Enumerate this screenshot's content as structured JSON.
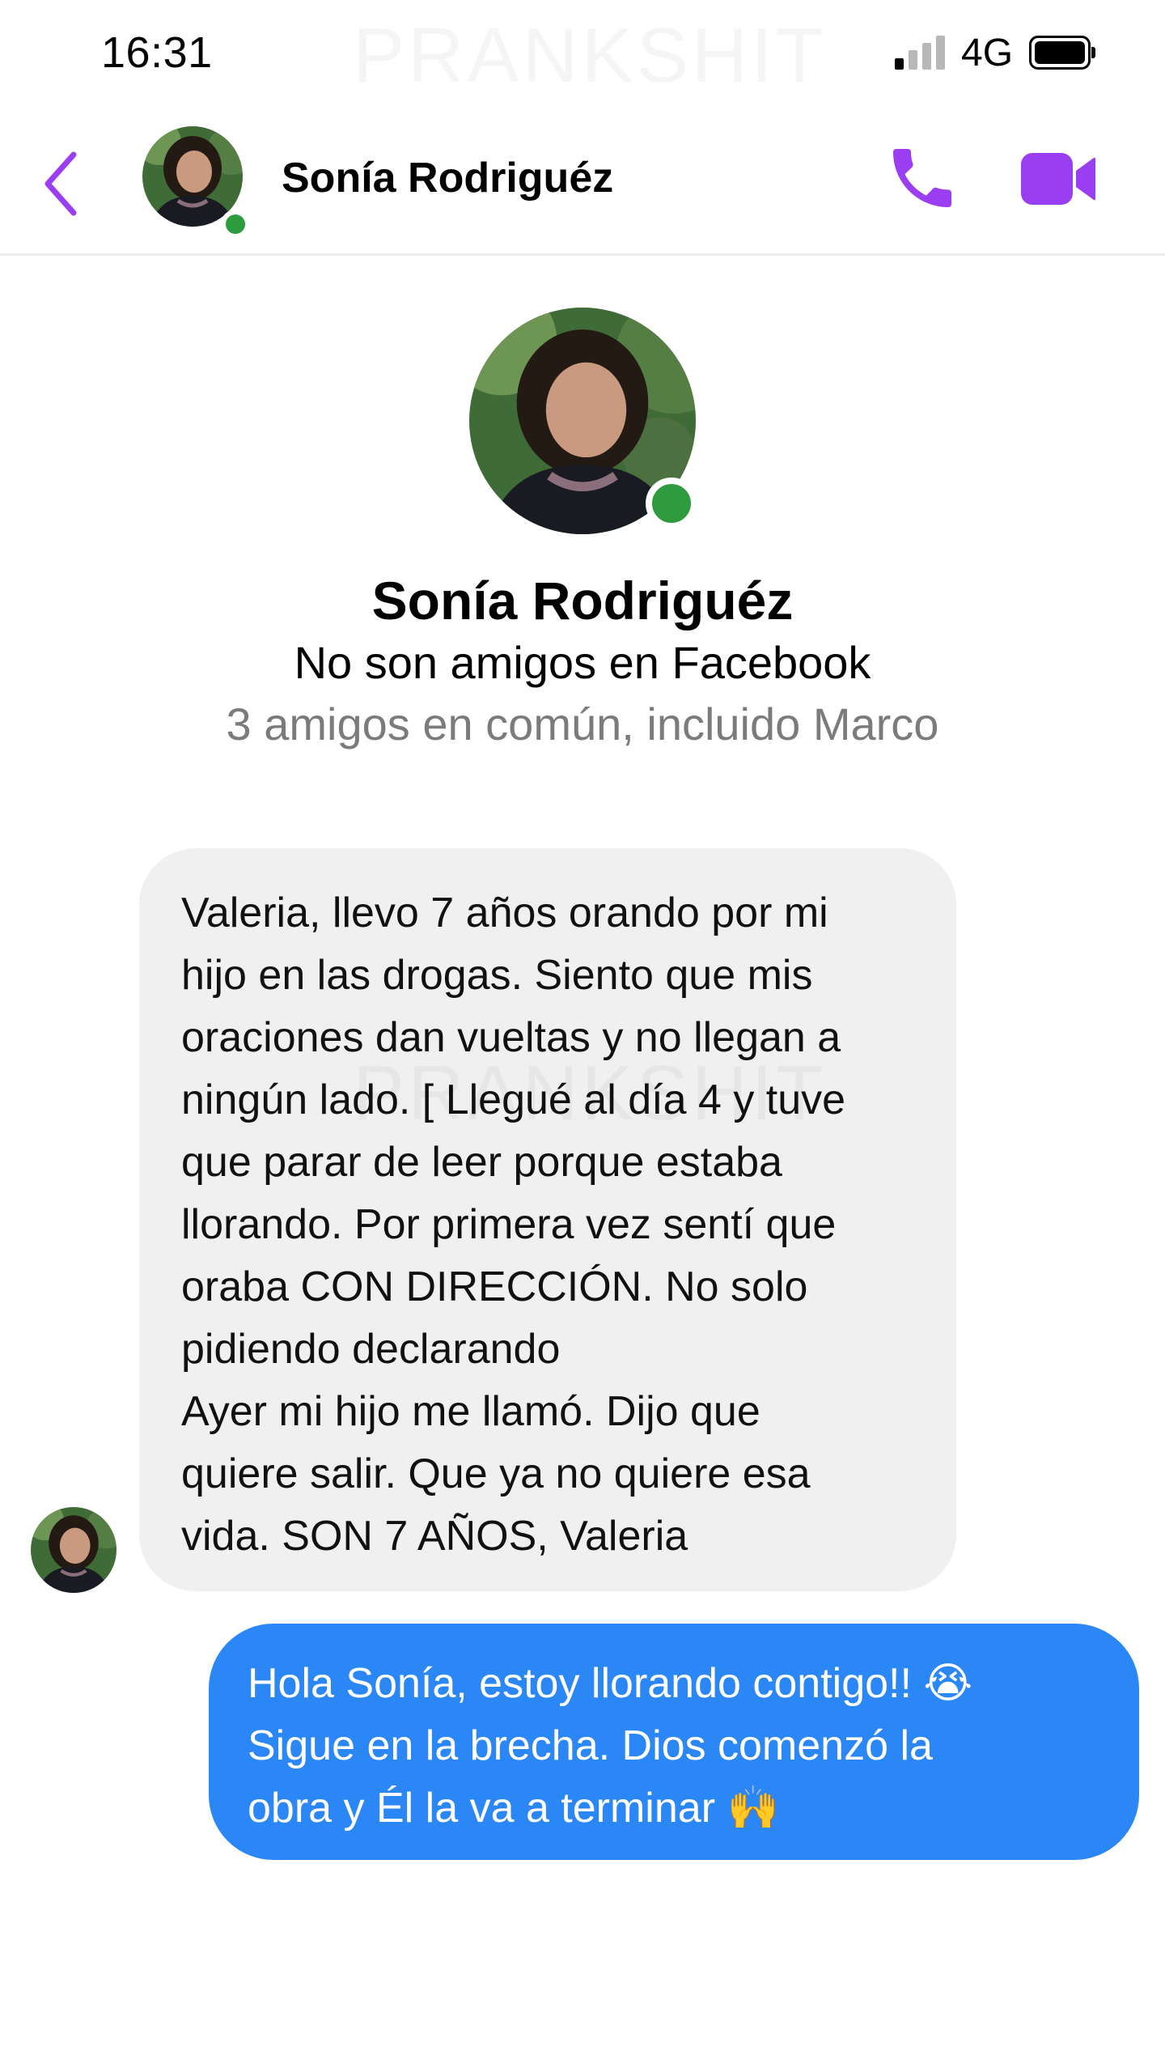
{
  "status_bar": {
    "time": "16:31",
    "network": "4G",
    "watermark": "PRANKSHIT",
    "icons": [
      "signal-icon",
      "battery-icon"
    ]
  },
  "header": {
    "name": "Sonía Rodriguéz",
    "icons": [
      "back-arrow-icon",
      "phone-icon",
      "video-camera-icon"
    ]
  },
  "profile": {
    "name": "Sonía Rodriguéz",
    "relation": "No son amigos en Facebook",
    "mutual": "3 amigos en común, incluido Marco"
  },
  "messages": {
    "incoming": "Valeria, llevo 7 años orando por mi\nhijo en las drogas. Siento que mis\noraciones dan vueltas y no llegan a\nningún lado. [ Llegué al día 4 y tuve\nque parar de leer porque estaba\nllorando. Por primera vez sentí que\noraba CON DIRECCIÓN. No solo\npidiendo declarando\nAyer mi hijo me llamó. Dijo que\nquiere salir. Que ya no quiere esa\nvida. SON 7 AÑOS, Valeria",
    "outgoing": "Hola Sonía, estoy llorando contigo!! 😭\nSigue en la brecha. Dios comenzó la\nobra y Él la va a terminar 🙌"
  },
  "colors": {
    "accent": "#9b3df0",
    "online": "#2e9b3f",
    "outgoing_bubble": "#2a87f5",
    "incoming_bubble": "#f0f0f0",
    "muted_text": "#7b7b7b"
  }
}
